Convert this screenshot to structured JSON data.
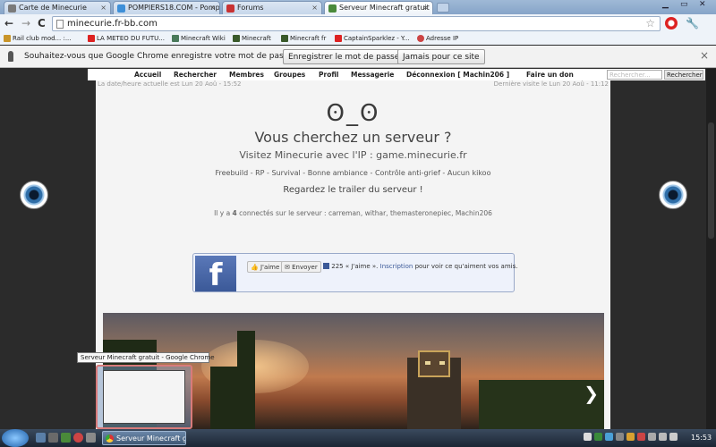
{
  "tabs": [
    {
      "label": "Carte de Minecurie",
      "active": false
    },
    {
      "label": "POMPIERS18.COM - Pomp",
      "active": false
    },
    {
      "label": "Forums",
      "active": false
    },
    {
      "label": "Serveur Minecraft gratuit",
      "active": true
    }
  ],
  "toolbar": {
    "url": "minecurie.fr-bb.com",
    "back": "←",
    "forward": "→",
    "reload": "C"
  },
  "bookmarks": [
    {
      "label": "Rail club mod... :..."
    },
    {
      "label": "LA METEO DU FUTU..."
    },
    {
      "label": "Minecraft Wiki"
    },
    {
      "label": "Minecraft"
    },
    {
      "label": "Minecraft fr"
    },
    {
      "label": "CaptainSparklez - Y..."
    },
    {
      "label": "Adresse IP"
    }
  ],
  "infobar": {
    "message": "Souhaitez-vous que Google Chrome enregistre votre mot de passe ?",
    "save_label": "Enregistrer le mot de passe",
    "never_label": "Jamais pour ce site"
  },
  "forum_nav": {
    "items": [
      "Accueil",
      "Rechercher",
      "Membres",
      "Groupes",
      "Profil",
      "Messagerie",
      "Déconnexion [ Machin206 ]",
      "Faire un don"
    ],
    "search_placeholder": "Rechercher...",
    "search_button": "Rechercher"
  },
  "page": {
    "date_left": "La date/heure actuelle est Lun 20 Aoû - 15:52",
    "date_right": "Dernière visite le Lun 20 Aoû - 11:12",
    "face": "ʘ_ʘ",
    "heading": "Vous cherchez un serveur ?",
    "subheading": "Visitez Minecurie avec l'IP : game.minecurie.fr",
    "tags": "Freebuild - RP - Survival - Bonne ambiance - Contrôle anti-grief - Aucun kikoo",
    "trailer": "Regardez le trailer du serveur !",
    "online_prefix": "Il y a ",
    "online_count": "4",
    "online_suffix": " connectés sur le serveur : carreman, withar, themasteronepiec, Machin206"
  },
  "facebook": {
    "logo": "f",
    "like_label": "J'aime",
    "send_label": "Envoyer",
    "count_text": "225 « J'aime ».",
    "signup_link": "Inscription",
    "signup_suffix": "pour voir ce qu'aiment vos amis."
  },
  "banner": {
    "next": "❯"
  },
  "taskbar": {
    "tooltip": "Serveur Minecraft gratuit - Google Chrome",
    "active_task": "Serveur Minecraft gr...",
    "clock": "15:53"
  }
}
